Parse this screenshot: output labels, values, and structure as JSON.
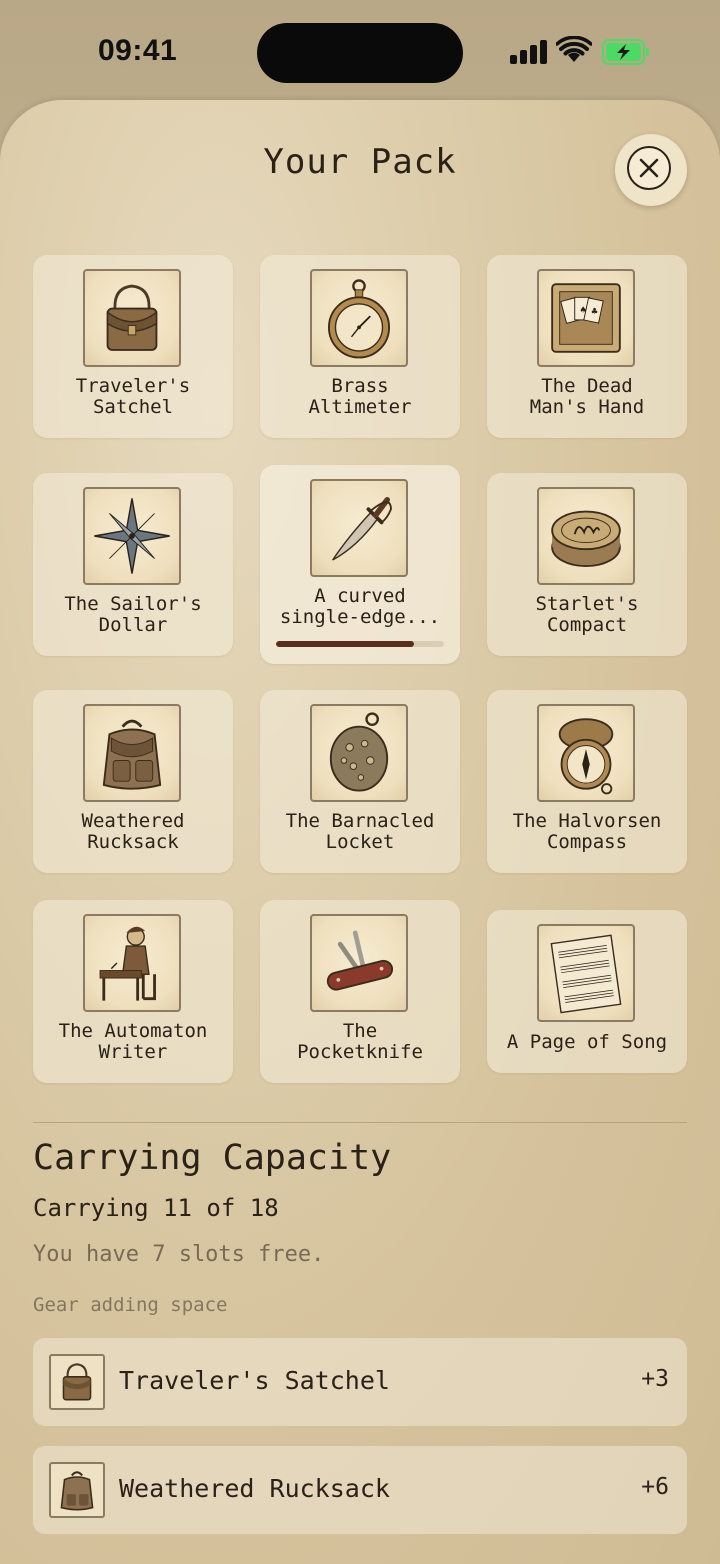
{
  "status": {
    "time": "09:41"
  },
  "sheet": {
    "title": "Your Pack"
  },
  "items": [
    {
      "label_1": "Traveler's",
      "label_2": "Satchel",
      "icon": "satchel-icon"
    },
    {
      "label_1": "Brass",
      "label_2": "Altimeter",
      "icon": "altimeter-icon"
    },
    {
      "label_1": "The Dead",
      "label_2": "Man's Hand",
      "icon": "playing-cards-icon"
    },
    {
      "label_1": "The Sailor's",
      "label_2": "Dollar",
      "icon": "compass-star-icon"
    },
    {
      "label_1": "A curved",
      "label_2": "single-edge...",
      "icon": "cutlass-icon",
      "progress": 0.82
    },
    {
      "label_1": "Starlet's",
      "label_2": "Compact",
      "icon": "compact-icon"
    },
    {
      "label_1": "Weathered",
      "label_2": "Rucksack",
      "icon": "rucksack-icon"
    },
    {
      "label_1": "The Barnacled",
      "label_2": "Locket",
      "icon": "locket-icon"
    },
    {
      "label_1": "The Halvorsen",
      "label_2": "Compass",
      "icon": "pocket-compass-icon"
    },
    {
      "label_1": "The Automaton",
      "label_2": "Writer",
      "icon": "automaton-icon"
    },
    {
      "label_1": "The",
      "label_2": "Pocketknife",
      "icon": "pocketknife-icon"
    },
    {
      "label_1": "A Page of Song",
      "label_2": "",
      "icon": "sheet-music-icon"
    }
  ],
  "capacity": {
    "title": "Carrying Capacity",
    "count_text": "Carrying 11 of 18",
    "free_text": "You have 7 slots free.",
    "gear_header": "Gear adding space",
    "gear": [
      {
        "name": "Traveler's Satchel",
        "bonus": "+3",
        "icon": "satchel-icon"
      },
      {
        "name": "Weathered Rucksack",
        "bonus": "+6",
        "icon": "rucksack-icon"
      }
    ]
  },
  "colors": {
    "progress_fill": "#5b2d1c",
    "battery": "#4cd964"
  }
}
